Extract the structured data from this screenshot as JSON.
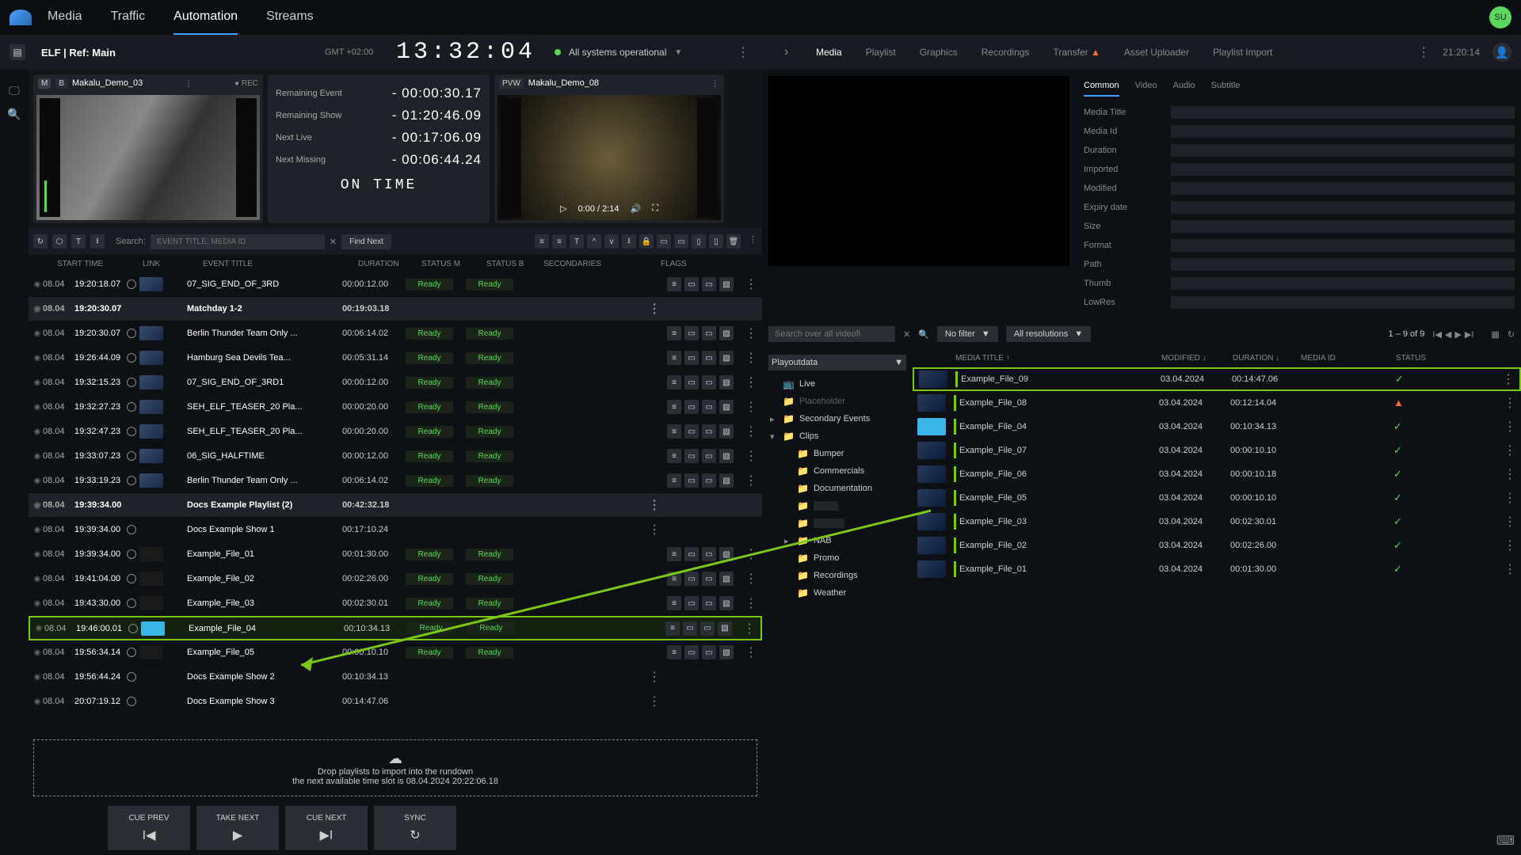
{
  "nav": {
    "tabs": [
      "Media",
      "Traffic",
      "Automation",
      "Streams"
    ],
    "active": 2,
    "avatar": "SU"
  },
  "subheader": {
    "channel": "ELF | Ref: Main",
    "gmt": "GMT +02:00",
    "clock": "13:32:04",
    "status": "All systems operational",
    "right_tabs": [
      "Media",
      "Playlist",
      "Graphics",
      "Recordings",
      "Transfer",
      "Asset Uploader",
      "Playlist Import"
    ],
    "right_active": 0,
    "transfer_warn": "▲",
    "right_time": "21:20:14"
  },
  "preview": {
    "main": {
      "badge_m": "M",
      "badge_b": "B",
      "title": "Makalu_Demo_03",
      "rec": "● REC"
    },
    "pvw": {
      "badge": "PVW",
      "title": "Makalu_Demo_08",
      "time": "0:00 / 2:14"
    },
    "timers": [
      {
        "label": "Remaining Event",
        "value": "- 00:00:30.17"
      },
      {
        "label": "Remaining Show",
        "value": "- 01:20:46.09"
      },
      {
        "label": "Next Live",
        "value": "- 00:17:06.09"
      },
      {
        "label": "Next Missing",
        "value": "- 00:06:44.24"
      }
    ],
    "on_time": "ON TIME"
  },
  "search": {
    "label": "Search:",
    "placeholder": "EVENT TITLE, MEDIA ID",
    "find": "Find Next"
  },
  "columns": {
    "start": "START TIME",
    "link": "LINK",
    "title": "EVENT TITLE",
    "dur": "DURATION",
    "sm": "STATUS M",
    "sb": "STATUS B",
    "sec": "SECONDARIES",
    "flags": "FLAGS"
  },
  "rows": [
    {
      "date": "08.04",
      "time": "19:20:18.07",
      "title": "07_SIG_END_OF_3RD",
      "dur": "00:00:12.00",
      "ready": true,
      "thumb": "std",
      "flags": true
    },
    {
      "date": "08.04",
      "time": "19:20:30.07",
      "title": "Matchday 1-2",
      "dur": "00:19:03.18",
      "group": true
    },
    {
      "date": "08.04",
      "time": "19:20:30.07",
      "title": "Berlin Thunder Team Only ...",
      "dur": "00:06:14.02",
      "ready": true,
      "thumb": "std",
      "flags": true
    },
    {
      "date": "08.04",
      "time": "19:26:44.09",
      "title": "Hamburg Sea Devils Tea...",
      "dur": "00:05:31.14",
      "ready": true,
      "thumb": "std",
      "flags": true
    },
    {
      "date": "08.04",
      "time": "19:32:15.23",
      "title": "07_SIG_END_OF_3RD1",
      "dur": "00:00:12.00",
      "ready": true,
      "thumb": "std",
      "flags": true
    },
    {
      "date": "08.04",
      "time": "19:32:27.23",
      "title": "SEH_ELF_TEASER_20 Pla...",
      "dur": "00:00:20.00",
      "ready": true,
      "thumb": "std",
      "flags": true
    },
    {
      "date": "08.04",
      "time": "19:32:47.23",
      "title": "SEH_ELF_TEASER_20 Pla...",
      "dur": "00:00:20.00",
      "ready": true,
      "thumb": "std",
      "flags": true
    },
    {
      "date": "08.04",
      "time": "19:33:07.23",
      "title": "06_SIG_HALFTIME",
      "dur": "00:00:12.00",
      "ready": true,
      "thumb": "std",
      "flags": true
    },
    {
      "date": "08.04",
      "time": "19:33:19.23",
      "title": "Berlin Thunder Team Only ...",
      "dur": "00:06:14.02",
      "ready": true,
      "thumb": "std",
      "flags": true
    },
    {
      "date": "08.04",
      "time": "19:39:34.00",
      "title": "Docs Example Playlist (2)",
      "dur": "00:42:32.18",
      "group": true
    },
    {
      "date": "08.04",
      "time": "19:39:34.00",
      "title": "Docs Example Show 1",
      "dur": "00:17:10.24",
      "group": false
    },
    {
      "date": "08.04",
      "time": "19:39:34.00",
      "title": "Example_File_01",
      "dur": "00:01:30.00",
      "ready": true,
      "thumb": "dark",
      "flags": true
    },
    {
      "date": "08.04",
      "time": "19:41:04.00",
      "title": "Example_File_02",
      "dur": "00:02:26.00",
      "ready": true,
      "thumb": "dark",
      "flags": true
    },
    {
      "date": "08.04",
      "time": "19:43:30.00",
      "title": "Example_File_03",
      "dur": "00:02:30.01",
      "ready": true,
      "thumb": "dark",
      "flags": true
    },
    {
      "date": "08.04",
      "time": "19:46:00.01",
      "title": "Example_File_04",
      "dur": "00:10:34.13",
      "ready": true,
      "thumb": "blue",
      "flags": true,
      "hl": true
    },
    {
      "date": "08.04",
      "time": "19:56:34.14",
      "title": "Example_File_05",
      "dur": "00:00:10.10",
      "ready": true,
      "thumb": "dark",
      "flags": true
    },
    {
      "date": "08.04",
      "time": "19:56:44.24",
      "title": "Docs Example Show 2",
      "dur": "00:10:34.13",
      "group": false
    },
    {
      "date": "08.04",
      "time": "20:07:19.12",
      "title": "Docs Example Show 3",
      "dur": "00:14:47.06",
      "group": false
    }
  ],
  "ready_label": "Ready",
  "drop": {
    "line1": "Drop playlists to import into the rundown",
    "line2": "the next available time slot is 08.04.2024 20:22:06.18"
  },
  "transport": {
    "cue_prev": "CUE PREV",
    "take": "TAKE NEXT",
    "cue_next": "CUE NEXT",
    "sync": "SYNC"
  },
  "details": {
    "tabs": [
      "Common",
      "Video",
      "Audio",
      "Subtitle"
    ],
    "fields": [
      "Media Title",
      "Media Id",
      "Duration",
      "Imported",
      "Modified",
      "Expiry date",
      "Size",
      "Format",
      "Path",
      "Thumb",
      "LowRes"
    ]
  },
  "filters": {
    "search_ph": "Search over all videofi",
    "no_filter": "No filter",
    "res": "All resolutions",
    "page": "1 – 9 of 9"
  },
  "tree": {
    "root": "Playoutdata",
    "items": [
      {
        "label": "Live",
        "ind": 0,
        "icon": "live"
      },
      {
        "label": "Placeholder",
        "ind": 0,
        "icon": "fold",
        "dim": true
      },
      {
        "label": "Secondary Events",
        "ind": 0,
        "icon": "fold",
        "chev": "▸"
      },
      {
        "label": "Clips",
        "ind": 0,
        "icon": "fold",
        "chev": "▾",
        "open": true
      },
      {
        "label": "Bumper",
        "ind": 1,
        "icon": "fold"
      },
      {
        "label": "Commercials",
        "ind": 1,
        "icon": "fold"
      },
      {
        "label": "Documentation",
        "ind": 1,
        "icon": "fold"
      },
      {
        "label": "▒▒▒▒",
        "ind": 1,
        "icon": "fold",
        "dim": true
      },
      {
        "label": "▒▒▒▒▒",
        "ind": 1,
        "icon": "fold",
        "dim": true
      },
      {
        "label": "NAB",
        "ind": 1,
        "icon": "fold",
        "chev": "▸"
      },
      {
        "label": "Promo",
        "ind": 1,
        "icon": "fold"
      },
      {
        "label": "Recordings",
        "ind": 1,
        "icon": "fold"
      },
      {
        "label": "Weather",
        "ind": 1,
        "icon": "fold"
      }
    ]
  },
  "grid": {
    "cols": {
      "title": "MEDIA TITLE",
      "mod": "MODIFIED",
      "dur": "DURATION",
      "mid": "MEDIA ID",
      "status": "STATUS"
    },
    "rows": [
      {
        "title": "Example_File_09",
        "mod": "03.04.2024",
        "dur": "00:14:47.06",
        "ok": true,
        "hl": true
      },
      {
        "title": "Example_File_08",
        "mod": "03.04.2024",
        "dur": "00:12:14.04",
        "ok": false
      },
      {
        "title": "Example_File_04",
        "mod": "03.04.2024",
        "dur": "00:10:34.13",
        "ok": true,
        "thumb": "blue"
      },
      {
        "title": "Example_File_07",
        "mod": "03.04.2024",
        "dur": "00:00:10.10",
        "ok": true
      },
      {
        "title": "Example_File_06",
        "mod": "03.04.2024",
        "dur": "00:00:10.18",
        "ok": true
      },
      {
        "title": "Example_File_05",
        "mod": "03.04.2024",
        "dur": "00:00:10.10",
        "ok": true
      },
      {
        "title": "Example_File_03",
        "mod": "03.04.2024",
        "dur": "00:02:30.01",
        "ok": true
      },
      {
        "title": "Example_File_02",
        "mod": "03.04.2024",
        "dur": "00:02:26.00",
        "ok": true
      },
      {
        "title": "Example_File_01",
        "mod": "03.04.2024",
        "dur": "00:01:30.00",
        "ok": true
      }
    ]
  }
}
